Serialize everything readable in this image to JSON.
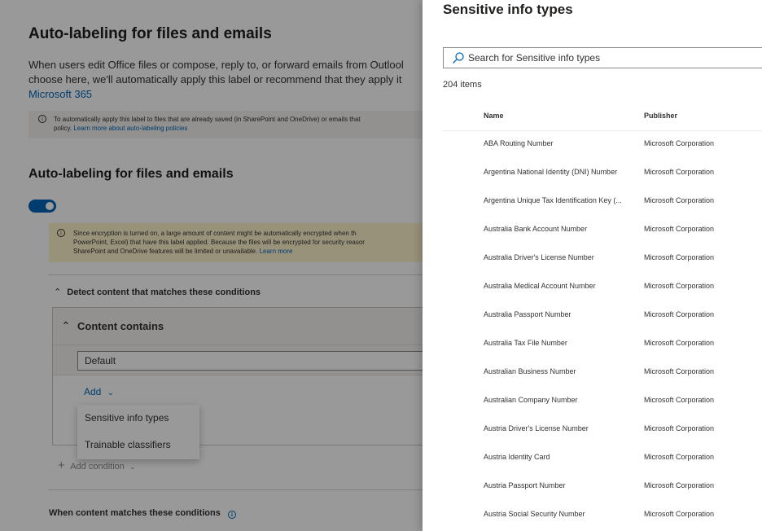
{
  "background": {
    "heading_main": "Auto-labeling for files and emails",
    "description_line1": "When users edit Office files or compose, reply to, or forward emails from Outlool",
    "description_line2": "choose here, we'll automatically apply this label or recommend that they apply it",
    "description_link": "Microsoft 365",
    "info_text_line1": "To automatically apply this label to files that are already saved (in SharePoint and OneDrive) or emails that",
    "info_text_line2_prefix": "policy.",
    "info_link": "Learn more about auto-labeling policies",
    "heading_section": "Auto-labeling for files and emails",
    "toggle_state": "on",
    "warning_line1": "Since encryption is turned on, a large amount of content might be automatically encrypted when th",
    "warning_line2": "PowerPoint, Excel) that have this label applied. Because the files will be encrypted for security reasor",
    "warning_line3_prefix": "SharePoint and OneDrive features will be limited or unavailable.",
    "warning_link": "Learn more",
    "detect_label": "Detect content that matches these conditions",
    "content_contains_label": "Content contains",
    "default_field_value": "Default",
    "add_label": "Add",
    "dropdown_items": [
      "Sensitive info types",
      "Trainable classifiers"
    ],
    "add_condition_label": "Add condition",
    "when_matches_label": "When content matches these conditions"
  },
  "panel": {
    "title": "Sensitive info types",
    "search_placeholder": "Search for Sensitive info types",
    "item_count": "204 items",
    "columns": {
      "name": "Name",
      "publisher": "Publisher"
    },
    "rows": [
      {
        "name": "ABA Routing Number",
        "publisher": "Microsoft Corporation"
      },
      {
        "name": "Argentina National Identity (DNI) Number",
        "publisher": "Microsoft Corporation"
      },
      {
        "name": "Argentina Unique Tax Identification Key (...",
        "publisher": "Microsoft Corporation"
      },
      {
        "name": "Australia Bank Account Number",
        "publisher": "Microsoft Corporation"
      },
      {
        "name": "Australia Driver's License Number",
        "publisher": "Microsoft Corporation"
      },
      {
        "name": "Australia Medical Account Number",
        "publisher": "Microsoft Corporation"
      },
      {
        "name": "Australia Passport Number",
        "publisher": "Microsoft Corporation"
      },
      {
        "name": "Australia Tax File Number",
        "publisher": "Microsoft Corporation"
      },
      {
        "name": "Australian Business Number",
        "publisher": "Microsoft Corporation"
      },
      {
        "name": "Australian Company Number",
        "publisher": "Microsoft Corporation"
      },
      {
        "name": "Austria Driver's License Number",
        "publisher": "Microsoft Corporation"
      },
      {
        "name": "Austria Identity Card",
        "publisher": "Microsoft Corporation"
      },
      {
        "name": "Austria Passport Number",
        "publisher": "Microsoft Corporation"
      },
      {
        "name": "Austria Social Security Number",
        "publisher": "Microsoft Corporation"
      }
    ]
  },
  "colors": {
    "accent": "#0067b8",
    "warning_bg": "#fff4ce",
    "info_bg": "#f3f2f1",
    "overlay": "rgba(0,0,0,0.40)"
  },
  "icons": [
    "search-icon",
    "info-icon",
    "chevron-up-icon",
    "chevron-down-icon",
    "plus-icon"
  ]
}
